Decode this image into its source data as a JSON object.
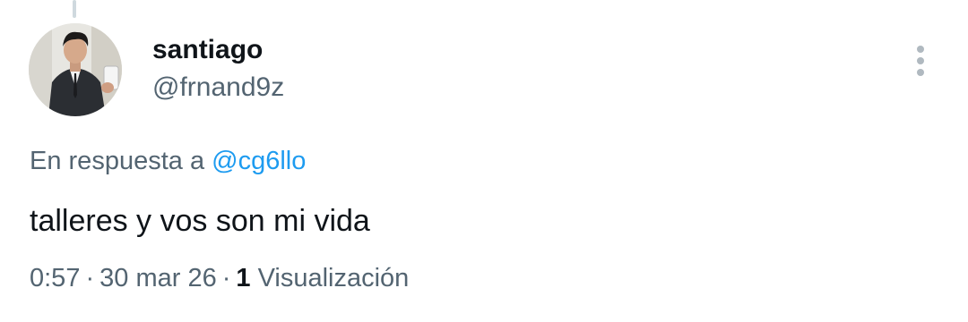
{
  "tweet": {
    "author": {
      "display_name": "santiago",
      "handle": "@frnand9z"
    },
    "more_icon": "more-vertical-icon",
    "reply_to": {
      "prefix": "En respuesta a",
      "mention": "@cg6llo"
    },
    "text": "talleres y vos son mi vida",
    "meta": {
      "time": "0:57",
      "separator": "·",
      "date": "30 mar 26",
      "views_count": "1",
      "views_label": "Visualización"
    }
  },
  "colors": {
    "text_primary": "#0f1419",
    "text_secondary": "#536471",
    "link": "#1d9bf0",
    "thread_line": "#cfd9de"
  }
}
